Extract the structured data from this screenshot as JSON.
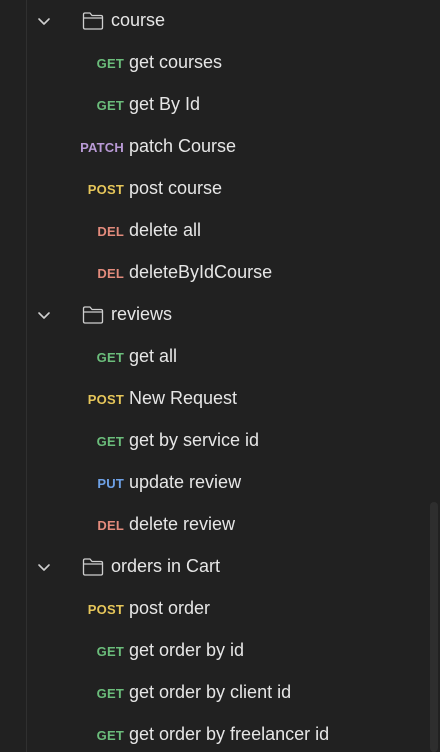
{
  "colors": {
    "background": "#212121",
    "text": "#e6e6e6",
    "icon": "#cfcfcf",
    "GET": "#6bbd7b",
    "POST": "#e6c65a",
    "PATCH": "#b99ad6",
    "PUT": "#6ea1e6",
    "DEL": "#e38b7c"
  },
  "tree": [
    {
      "type": "folder",
      "name": "course",
      "expanded": true,
      "icon": "folder-icon",
      "requests": [
        {
          "method": "GET",
          "name": "get courses"
        },
        {
          "method": "GET",
          "name": "get By Id"
        },
        {
          "method": "PATCH",
          "name": "patch Course"
        },
        {
          "method": "POST",
          "name": "post course"
        },
        {
          "method": "DEL",
          "name": "delete all"
        },
        {
          "method": "DEL",
          "name": "deleteByIdCourse"
        }
      ]
    },
    {
      "type": "folder",
      "name": "reviews",
      "expanded": true,
      "icon": "folder-icon",
      "requests": [
        {
          "method": "GET",
          "name": "get all"
        },
        {
          "method": "POST",
          "name": "New Request"
        },
        {
          "method": "GET",
          "name": "get by service id"
        },
        {
          "method": "PUT",
          "name": "update review"
        },
        {
          "method": "DEL",
          "name": "delete review"
        }
      ]
    },
    {
      "type": "folder",
      "name": "orders in Cart",
      "expanded": true,
      "icon": "folder-icon",
      "requests": [
        {
          "method": "POST",
          "name": "post order"
        },
        {
          "method": "GET",
          "name": "get order by id"
        },
        {
          "method": "GET",
          "name": "get order by client id"
        },
        {
          "method": "GET",
          "name": "get order by freelancer id"
        }
      ]
    }
  ]
}
